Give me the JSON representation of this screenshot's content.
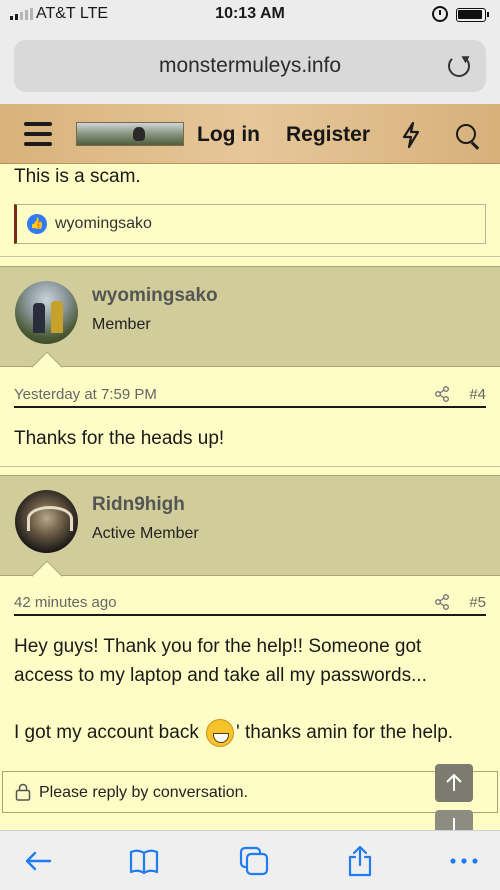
{
  "status": {
    "carrier": "AT&T  LTE",
    "time": "10:13 AM"
  },
  "browser": {
    "url": "monstermuleys.info"
  },
  "header": {
    "login": "Log in",
    "register": "Register"
  },
  "post3": {
    "text": "This is a scam.",
    "reaction_user": "wyomingsako"
  },
  "post4": {
    "username": "wyomingsako",
    "user_title": "Member",
    "time": "Yesterday at 7:59 PM",
    "number": "#4",
    "message": "Thanks for the heads up!"
  },
  "post5": {
    "username": "Ridn9high",
    "user_title": "Active Member",
    "time": "42 minutes ago",
    "number": "#5",
    "message_line1": "Hey guys! Thank you for the help!! Someone got",
    "message_line2": "access to my laptop and take all my passwords...",
    "message_line3a": "I got my account back",
    "message_line3b": "' thanks amin for the help."
  },
  "reply_notice": "Please reply by conversation.",
  "colors": {
    "page_bg": "#fffdc6",
    "user_block_bg": "#d1cd9a",
    "accent_blue": "#2d7cf6"
  }
}
